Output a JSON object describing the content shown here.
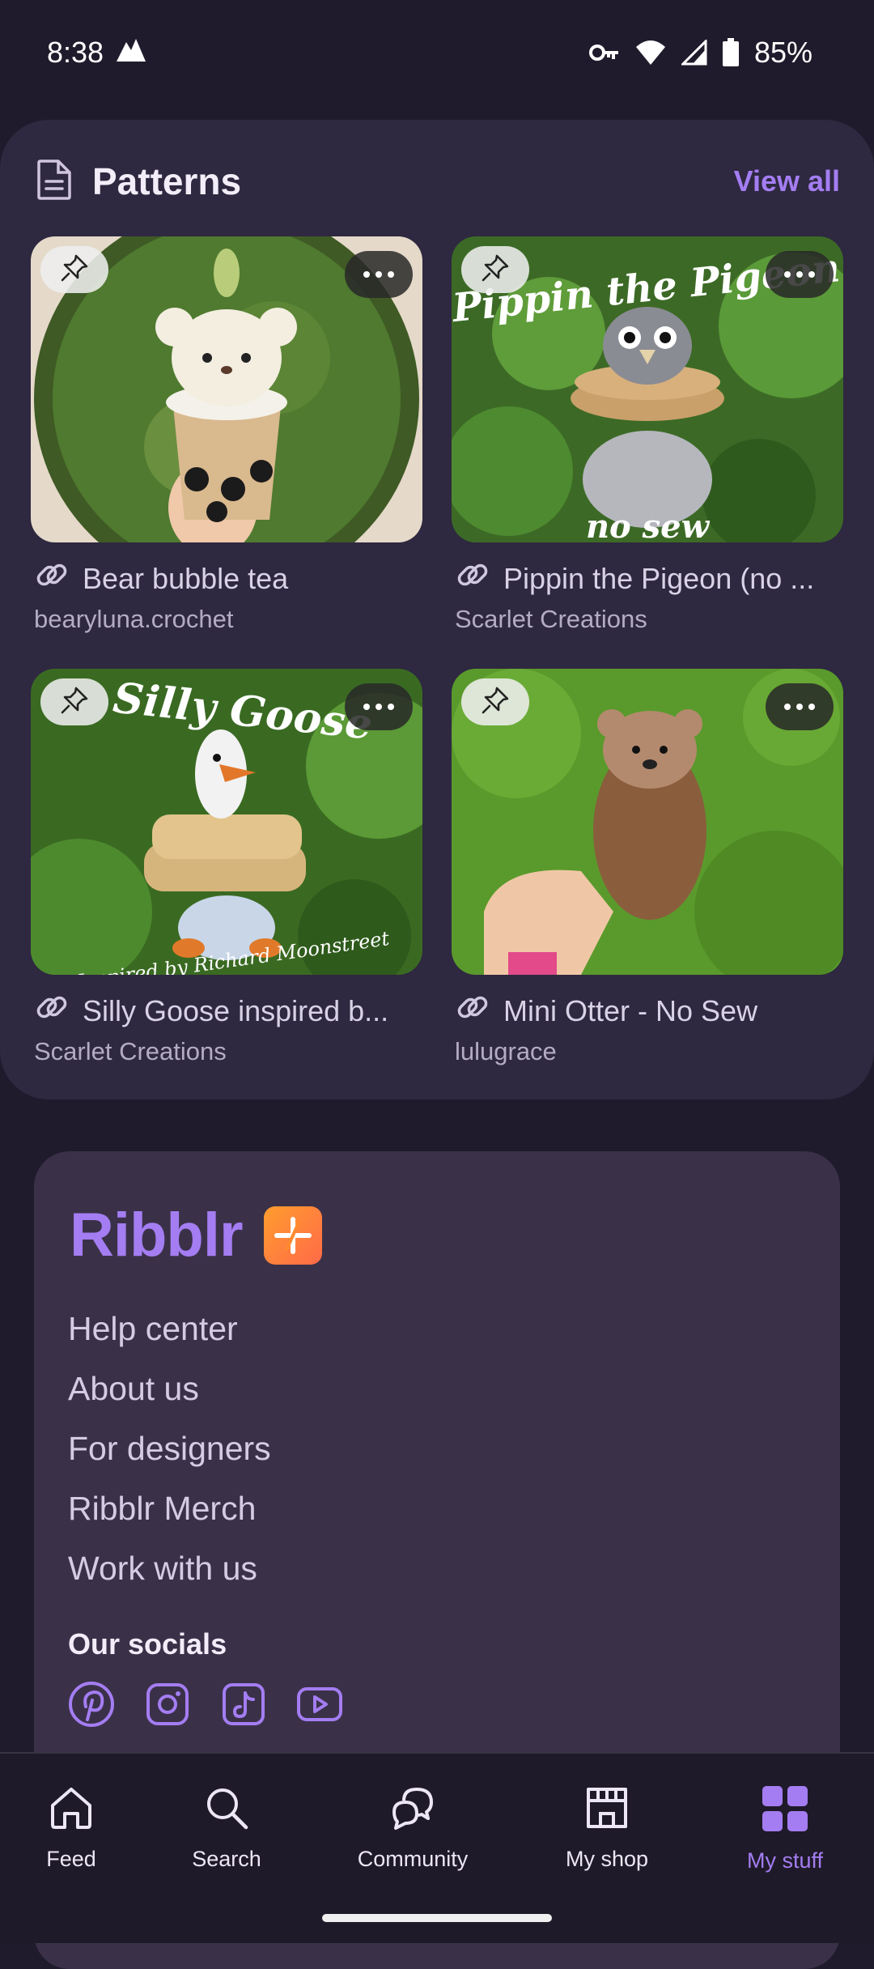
{
  "status_bar": {
    "time": "8:38",
    "battery": "85%"
  },
  "patterns": {
    "title": "Patterns",
    "view_all": "View all",
    "items": [
      {
        "title": "Bear bubble tea",
        "author": "bearyluna.crochet",
        "image_text": "",
        "image_text_2": ""
      },
      {
        "title": "Pippin the Pigeon (no ...",
        "author": "Scarlet Creations",
        "image_text": "Pippin the Pigeon",
        "image_text_2": "no sew"
      },
      {
        "title": "Silly Goose inspired b...",
        "author": "Scarlet Creations",
        "image_text": "Silly Goose",
        "image_text_2": "Inspired by Richard Moonstreet"
      },
      {
        "title": "Mini Otter - No Sew",
        "author": "lulugrace",
        "image_text": "",
        "image_text_2": ""
      }
    ]
  },
  "footer": {
    "brand": "Ribblr",
    "links": [
      "Help center",
      "About us",
      "For designers",
      "Ribblr Merch",
      "Work with us"
    ],
    "socials_title": "Our socials",
    "socials": [
      "pinterest-icon",
      "instagram-icon",
      "tiktok-icon",
      "youtube-icon"
    ]
  },
  "nav": {
    "items": [
      {
        "label": "Feed",
        "icon": "home-icon"
      },
      {
        "label": "Search",
        "icon": "search-icon"
      },
      {
        "label": "Community",
        "icon": "chat-icon"
      },
      {
        "label": "My shop",
        "icon": "shop-icon"
      },
      {
        "label": "My stuff",
        "icon": "grid-icon"
      }
    ],
    "active": "My stuff"
  },
  "colors": {
    "accent": "#a47df2",
    "background": "#201b2c",
    "card": "#2e2840",
    "footer_card": "#3a3149"
  }
}
